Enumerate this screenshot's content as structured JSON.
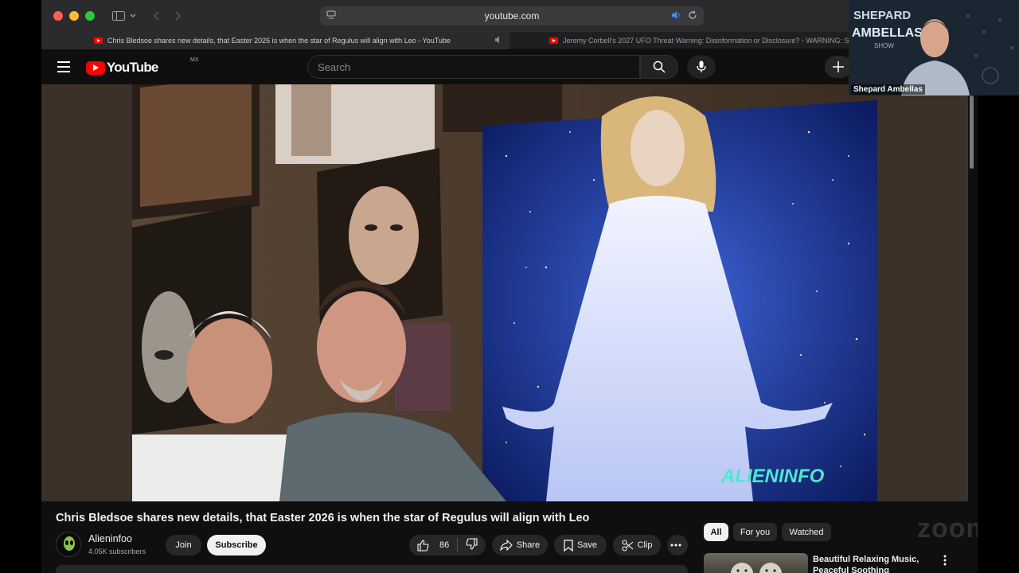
{
  "browser": {
    "url": "youtube.com",
    "tabs": [
      {
        "title": "Chris Bledsoe shares new details, that Easter 2026 is when the star of Regulus will align with Leo - YouTube"
      },
      {
        "title": "Jeremy Corbell's 2027 UFO Threat Warning: Disinformation or Disclosure? - WARNING: S"
      }
    ]
  },
  "youtube": {
    "logo_text": "YouTube",
    "country_code": "MX",
    "search_placeholder": "Search"
  },
  "video": {
    "watermark": "ALIENINFO",
    "title": "Chris Bledsoe shares new details, that Easter 2026 is when the star of Regulus will align with Leo"
  },
  "channel": {
    "name": "Alieninfoo",
    "subscribers": "4.05K subscribers",
    "join_label": "Join",
    "subscribe_label": "Subscribe"
  },
  "actions": {
    "like_count": "86",
    "share_label": "Share",
    "save_label": "Save",
    "clip_label": "Clip"
  },
  "filters": {
    "chips": [
      "All",
      "For you",
      "Watched"
    ]
  },
  "recommendation": {
    "title": "Beautiful Relaxing Music, Peaceful Soothing Instrument"
  },
  "webcam": {
    "name": "Shepard Ambellas",
    "backdrop_text_1": "SHEPARD",
    "backdrop_text_2": "AMBELLAS",
    "backdrop_text_3": "SHOW"
  },
  "overlay": {
    "zoom_watermark": "zoom"
  },
  "colors": {
    "yt_red": "#ff0000",
    "page_bg": "#0f0f0f",
    "chip_bg": "#272727"
  }
}
